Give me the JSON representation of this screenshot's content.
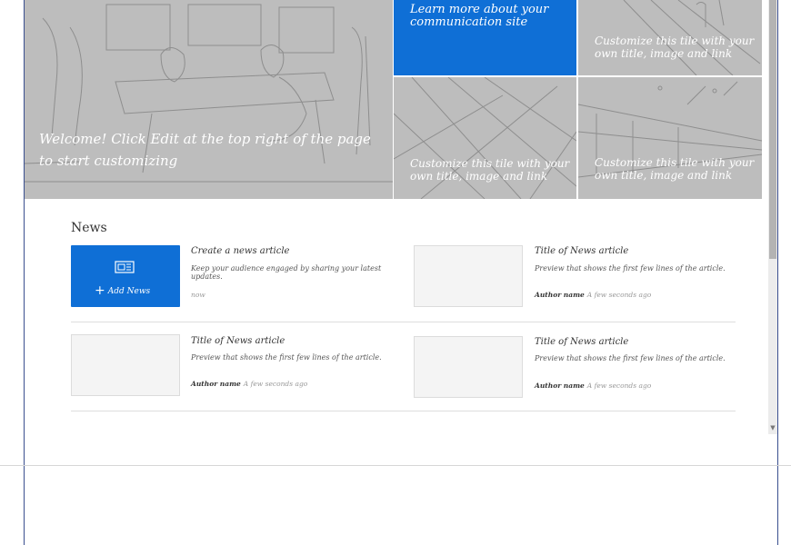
{
  "tiles": {
    "hero": {
      "text": "Welcome! Click Edit at the top right of the page to start customizing"
    },
    "learn_more": {
      "text": "Learn more about your communication site",
      "color": "#0f6fd6"
    },
    "top_right": {
      "text": "Customize this tile with your own title, image and link"
    },
    "bottom_middle": {
      "text": "Customize this tile with your own title, image and link"
    },
    "bottom_right": {
      "text": "Customize this tile with your own title, image and link"
    }
  },
  "news": {
    "heading": "News",
    "add_news": {
      "label": "Add News",
      "icon": "news-add-icon"
    },
    "create_article": {
      "title": "Create a news article",
      "preview": "Keep your audience engaged by sharing your latest updates.",
      "time": "now"
    },
    "articles": [
      {
        "title": "Title of News article",
        "preview": "Preview that shows the first few lines of the article.",
        "author": "Author name",
        "time": "A few seconds ago"
      },
      {
        "title": "Title of News article",
        "preview": "Preview that shows the first few lines of the article.",
        "author": "Author name",
        "time": "A few seconds ago"
      },
      {
        "title": "Title of News article",
        "preview": "Preview that shows the first few lines of the article.",
        "author": "Author name",
        "time": "A few seconds ago"
      }
    ]
  }
}
